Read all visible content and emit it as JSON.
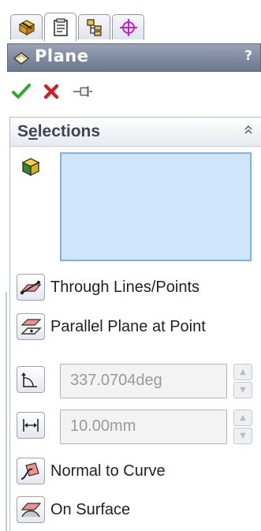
{
  "tabs": [
    {
      "icon": "feature-manager-tree-icon",
      "active": false
    },
    {
      "icon": "property-manager-icon",
      "active": true
    },
    {
      "icon": "configuration-manager-icon",
      "active": false
    },
    {
      "icon": "dimxpert-manager-icon",
      "active": false
    }
  ],
  "panel": {
    "title": "Plane",
    "help": "?",
    "title_icon": "plane-icon"
  },
  "actions": {
    "ok_icon": "ok-checkmark-icon",
    "cancel_icon": "cancel-x-icon",
    "pin_icon": "pushpin-icon"
  },
  "selections": {
    "title_first": "S",
    "title_underlined": "e",
    "title_rest": "lections",
    "list_items": [],
    "options": [
      {
        "label": "Through Lines/Points"
      },
      {
        "label": "Parallel Plane at Point"
      }
    ],
    "angle": {
      "value": "337.0704deg"
    },
    "distance": {
      "value": "10.00mm"
    },
    "options2": [
      {
        "label": "Normal to Curve"
      },
      {
        "label": "On Surface"
      }
    ]
  },
  "colors": {
    "titlebar": "#7f89a0",
    "selection_box": "#cfe5fb",
    "selection_border": "#7fb2e6",
    "ok_green": "#2eaa2e",
    "cancel_red": "#d8181a",
    "dimxpert_magenta": "#c820c8"
  }
}
